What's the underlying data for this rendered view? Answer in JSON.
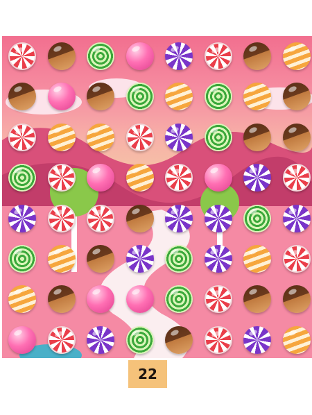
{
  "board": {
    "rows": [
      [
        "peppermint",
        "chocolate",
        "green",
        "pink",
        "purple",
        "peppermint",
        "chocolate",
        "orange"
      ],
      [
        "chocolate",
        "pink",
        "chocolate",
        "green",
        "orange",
        "green",
        "orange",
        "chocolate"
      ],
      [
        "peppermint",
        "orange",
        "orange",
        "peppermint",
        "purple",
        "green",
        "chocolate",
        "chocolate"
      ],
      [
        "green",
        "peppermint",
        "pink",
        "orange",
        "peppermint",
        "pink",
        "purple",
        "peppermint"
      ],
      [
        "purple",
        "peppermint",
        "peppermint",
        "chocolate",
        "purple",
        "purple",
        "green",
        "purple"
      ],
      [
        "green",
        "orange",
        "chocolate",
        "purple",
        "green",
        "purple",
        "orange",
        "peppermint"
      ],
      [
        "orange",
        "chocolate",
        "pink",
        "pink",
        "green",
        "peppermint",
        "chocolate",
        "chocolate"
      ],
      [
        "pink",
        "peppermint",
        "purple",
        "green",
        "chocolate",
        "peppermint",
        "purple",
        "orange"
      ]
    ]
  },
  "moves": {
    "value": "22"
  },
  "colors": {
    "moves_bg": "#f5c27a",
    "peppermint": "#ea3e4a",
    "chocolate": "#6b3a1d",
    "green": "#3aa83a",
    "pink": "#ff6fb3",
    "purple": "#7a35c9",
    "orange": "#f6a63d"
  }
}
